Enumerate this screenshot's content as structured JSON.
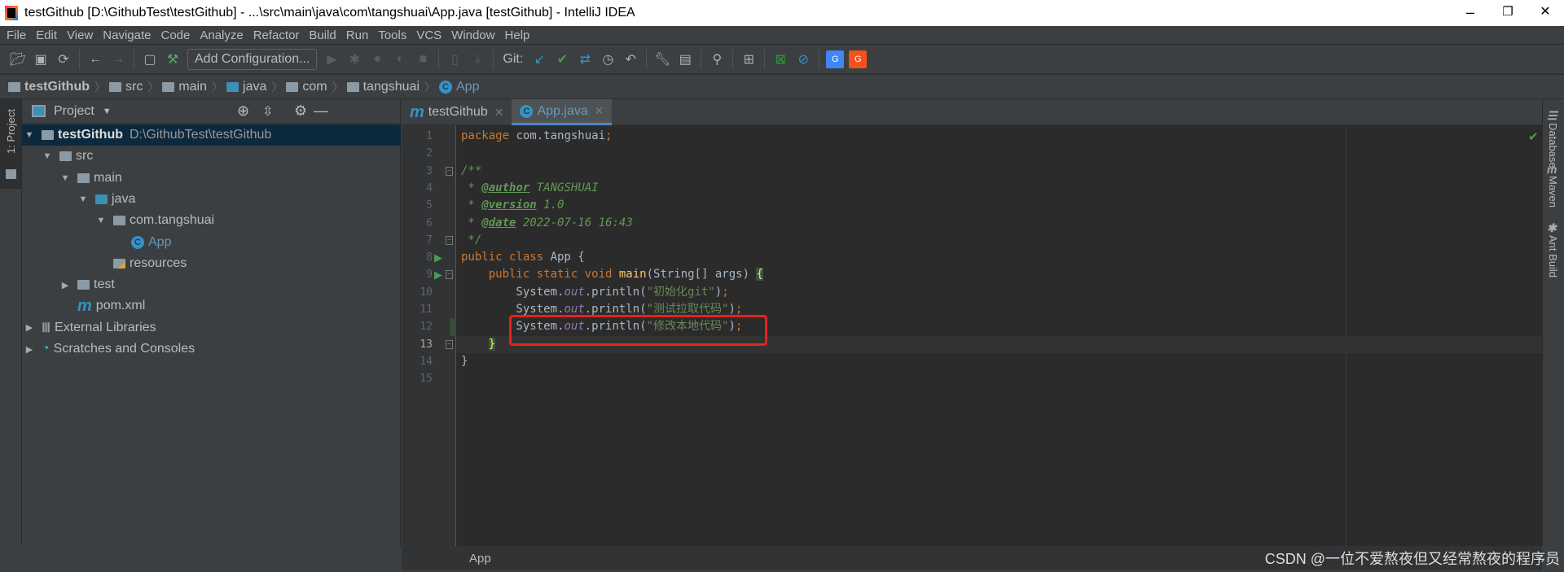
{
  "window": {
    "title": "testGithub [D:\\GithubTest\\testGithub] - ...\\src\\main\\java\\com\\tangshuai\\App.java [testGithub] - IntelliJ IDEA",
    "minimize": "–",
    "restore": "❐",
    "close": "✕"
  },
  "menu": [
    "File",
    "Edit",
    "View",
    "Navigate",
    "Code",
    "Analyze",
    "Refactor",
    "Build",
    "Run",
    "Tools",
    "VCS",
    "Window",
    "Help"
  ],
  "toolbar": {
    "add_configuration": "Add Configuration...",
    "git_label": "Git:"
  },
  "breadcrumb": [
    {
      "label": "testGithub",
      "icon": "project-folder"
    },
    {
      "label": "src",
      "icon": "folder"
    },
    {
      "label": "main",
      "icon": "folder"
    },
    {
      "label": "java",
      "icon": "source-folder"
    },
    {
      "label": "com",
      "icon": "package"
    },
    {
      "label": "tangshuai",
      "icon": "package"
    },
    {
      "label": "App",
      "icon": "class"
    }
  ],
  "left_stripe": {
    "project_tab": "1: Project"
  },
  "project": {
    "title": "Project",
    "tree": [
      {
        "label": "testGithub",
        "path": "D:\\GithubTest\\testGithub",
        "depth": 0,
        "expanded": true,
        "icon": "project-folder",
        "selected": true
      },
      {
        "label": "src",
        "depth": 1,
        "expanded": true,
        "icon": "folder"
      },
      {
        "label": "main",
        "depth": 2,
        "expanded": true,
        "icon": "folder"
      },
      {
        "label": "java",
        "depth": 3,
        "expanded": true,
        "icon": "source-folder"
      },
      {
        "label": "com.tangshuai",
        "depth": 4,
        "expanded": true,
        "icon": "package"
      },
      {
        "label": "App",
        "depth": 5,
        "icon": "class"
      },
      {
        "label": "resources",
        "depth": 4,
        "icon": "resources-folder"
      },
      {
        "label": "test",
        "depth": 2,
        "expanded": false,
        "icon": "folder"
      },
      {
        "label": "pom.xml",
        "depth": 2,
        "icon": "maven"
      },
      {
        "label": "External Libraries",
        "depth": 0,
        "expanded": false,
        "icon": "libraries"
      },
      {
        "label": "Scratches and Consoles",
        "depth": 0,
        "expanded": false,
        "icon": "scratches"
      }
    ]
  },
  "editor": {
    "tabs": [
      {
        "label": "testGithub",
        "icon": "maven",
        "active": false
      },
      {
        "label": "App.java",
        "icon": "class",
        "active": true
      }
    ],
    "current_line": 13,
    "lines": [
      [
        {
          "t": "package ",
          "c": "kw"
        },
        {
          "t": "com.tangshuai",
          "c": "tx"
        },
        {
          "t": ";",
          "c": "kw"
        }
      ],
      [],
      [
        {
          "t": "/**",
          "c": "cm"
        }
      ],
      [
        {
          "t": " * ",
          "c": "cm"
        },
        {
          "t": "@author",
          "c": "tag"
        },
        {
          "t": " TANGSHUAI",
          "c": "cm"
        }
      ],
      [
        {
          "t": " * ",
          "c": "cm"
        },
        {
          "t": "@version",
          "c": "tag"
        },
        {
          "t": " 1.0",
          "c": "cm"
        }
      ],
      [
        {
          "t": " * ",
          "c": "cm"
        },
        {
          "t": "@date",
          "c": "tag"
        },
        {
          "t": " 2022-07-16 16:43",
          "c": "cm"
        }
      ],
      [
        {
          "t": " */",
          "c": "cm"
        }
      ],
      [
        {
          "t": "public class ",
          "c": "kw"
        },
        {
          "t": "App {",
          "c": "tx"
        }
      ],
      [
        {
          "t": "    public static void ",
          "c": "kw"
        },
        {
          "t": "main",
          "c": "fn"
        },
        {
          "t": "(String[] args) ",
          "c": "tx"
        },
        {
          "t": "{",
          "c": "br"
        }
      ],
      [
        {
          "t": "        System.",
          "c": "tx"
        },
        {
          "t": "out",
          "c": "fd"
        },
        {
          "t": ".println(",
          "c": "tx"
        },
        {
          "t": "\"初始化git\"",
          "c": "st"
        },
        {
          "t": ")",
          "c": "tx"
        },
        {
          "t": ";",
          "c": "kw"
        }
      ],
      [
        {
          "t": "        System.",
          "c": "tx"
        },
        {
          "t": "out",
          "c": "fd"
        },
        {
          "t": ".println(",
          "c": "tx"
        },
        {
          "t": "\"测试拉取代码\"",
          "c": "st"
        },
        {
          "t": ")",
          "c": "tx"
        },
        {
          "t": ";",
          "c": "kw"
        }
      ],
      [
        {
          "t": "        System.",
          "c": "tx"
        },
        {
          "t": "out",
          "c": "fd"
        },
        {
          "t": ".println(",
          "c": "tx"
        },
        {
          "t": "\"修改本地代码\"",
          "c": "st"
        },
        {
          "t": ")",
          "c": "tx"
        },
        {
          "t": ";",
          "c": "kw"
        }
      ],
      [
        {
          "t": "    ",
          "c": "tx"
        },
        {
          "t": "}",
          "c": "br"
        }
      ],
      [
        {
          "t": "}",
          "c": "tx"
        }
      ],
      []
    ]
  },
  "right_stripe": [
    "Database",
    "Maven",
    "Ant Build"
  ],
  "statusbar": {
    "breadcrumb": "App",
    "watermark": "CSDN @一位不爱熬夜但又经常熬夜的程序员"
  },
  "colors": {
    "kw": "#cc7832",
    "tx": "#a9b7c6",
    "cm": "#629755",
    "tag": "#629755",
    "st": "#6a8759",
    "fd": "#9876aa",
    "fn": "#ffc66d",
    "br": "#ffef28",
    "highlight_box": "#e8221a",
    "accent": "#4a88c7"
  }
}
